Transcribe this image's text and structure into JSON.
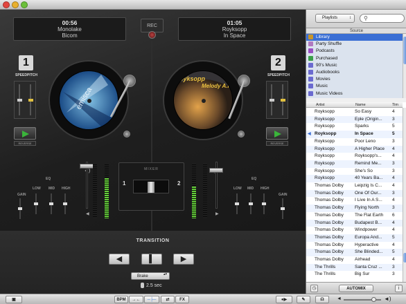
{
  "deck1": {
    "time": "00:56",
    "artist": "Monolake",
    "title": "Bicom",
    "number": "1",
    "pitch_label": "PITCH",
    "speed_label": "SPEED",
    "reverse_label": "REVERSE"
  },
  "deck2": {
    "time": "01:05",
    "artist": "Royksopp",
    "title": "In Space",
    "number": "2",
    "pitch_label": "PITCH",
    "speed_label": "SPEED",
    "reverse_label": "REVERSE"
  },
  "rec_label": "REC",
  "mixer": {
    "title": "MIXER",
    "left": "1",
    "right": "2",
    "eq_label": "EQ",
    "gain_label": "GAIN",
    "low": "LOW",
    "mid": "MID",
    "high": "HIGH"
  },
  "transition": {
    "title": "TRANSITION",
    "prev": "◀",
    "stop": "▌",
    "next": "▶",
    "mode": "Brake",
    "duration": "2.5 sec"
  },
  "bottombar": {
    "bpm": "BPM",
    "fx": "FX"
  },
  "library": {
    "playlists_label": "Playlists",
    "source_label": "Source",
    "sources": [
      {
        "label": "Library",
        "color": "#c8962a",
        "selected": true
      },
      {
        "label": "Party Shuffle",
        "color": "#b07ac0",
        "selected": false
      },
      {
        "label": "Podcasts",
        "color": "#9a4fc4",
        "selected": false
      },
      {
        "label": "Purchased",
        "color": "#3aa04a",
        "selected": false
      },
      {
        "label": "90's Music",
        "color": "#6a6ad0",
        "selected": false
      },
      {
        "label": "Audiobooks",
        "color": "#6a6ad0",
        "selected": false
      },
      {
        "label": "Movies",
        "color": "#6a6ad0",
        "selected": false
      },
      {
        "label": "Music",
        "color": "#6a6ad0",
        "selected": false
      },
      {
        "label": "Music Videos",
        "color": "#6a6ad0",
        "selected": false
      }
    ],
    "columns": {
      "artist": "Artist",
      "name": "Name",
      "time": "Tim"
    },
    "tracks": [
      {
        "artist": "Royksopp",
        "name": "So Easy",
        "time": "4"
      },
      {
        "artist": "Royksopp",
        "name": "Eple (Origin...",
        "time": "3"
      },
      {
        "artist": "Royksopp",
        "name": "Sparks",
        "time": "5"
      },
      {
        "artist": "Royksopp",
        "name": "In Space",
        "time": "5"
      },
      {
        "artist": "Royksopp",
        "name": "Poor Leno",
        "time": "3"
      },
      {
        "artist": "Royksopp",
        "name": "A Higher Place",
        "time": "4"
      },
      {
        "artist": "Royksopp",
        "name": "Royksopp's...",
        "time": "4"
      },
      {
        "artist": "Royksopp",
        "name": "Remind Me...",
        "time": "3"
      },
      {
        "artist": "Royksopp",
        "name": "She's So",
        "time": "3"
      },
      {
        "artist": "Royksopp",
        "name": "40 Years Ba...",
        "time": "4"
      },
      {
        "artist": "Thomas Dolby",
        "name": "Leipzig Is C...",
        "time": "4"
      },
      {
        "artist": "Thomas Dolby",
        "name": "One Of Our...",
        "time": "3"
      },
      {
        "artist": "Thomas Dolby",
        "name": "I Live In A S...",
        "time": "4"
      },
      {
        "artist": "Thomas Dolby",
        "name": "Flying North",
        "time": "3"
      },
      {
        "artist": "Thomas Dolby",
        "name": "The Flat Earth",
        "time": "6"
      },
      {
        "artist": "Thomas Dolby",
        "name": "Budapest B...",
        "time": "4"
      },
      {
        "artist": "Thomas Dolby",
        "name": "Windpower",
        "time": "4"
      },
      {
        "artist": "Thomas Dolby",
        "name": "Europa And...",
        "time": "5"
      },
      {
        "artist": "Thomas Dolby",
        "name": "Hyperactive",
        "time": "4"
      },
      {
        "artist": "Thomas Dolby",
        "name": "She Blinded...",
        "time": "5"
      },
      {
        "artist": "Thomas Dolby",
        "name": "Airhead",
        "time": "4"
      },
      {
        "artist": "The Thrills",
        "name": "Santa Cruz ...",
        "time": "3"
      },
      {
        "artist": "The Thrills",
        "name": "Big Sur",
        "time": "3"
      }
    ],
    "playing_index": 3,
    "automix_label": "AUTOMIX"
  }
}
